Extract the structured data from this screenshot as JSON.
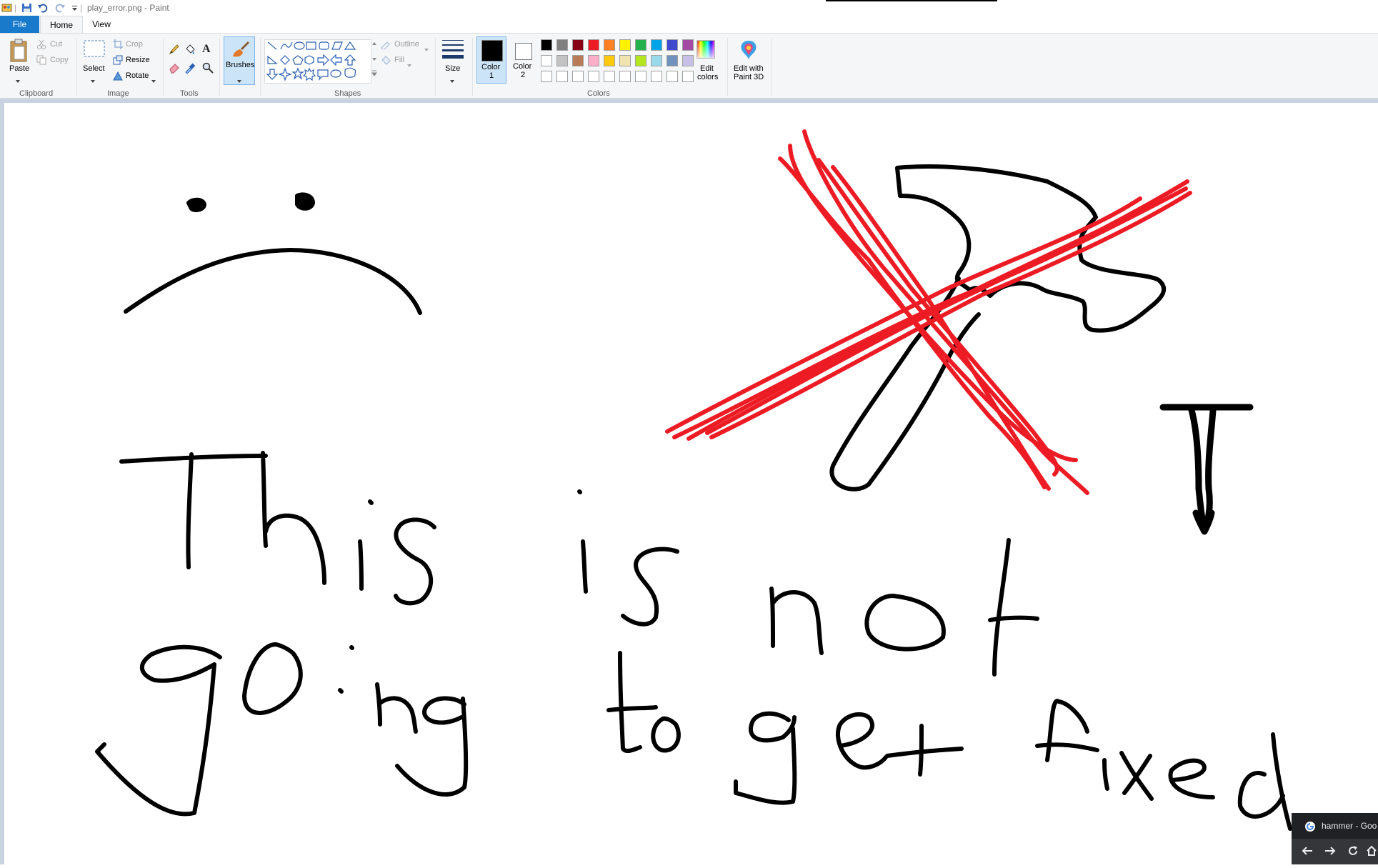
{
  "window": {
    "title": "play_error.png - Paint"
  },
  "tabs": {
    "file": "File",
    "home": "Home",
    "view": "View"
  },
  "clipboard": {
    "paste": "Paste",
    "cut": "Cut",
    "copy": "Copy",
    "label": "Clipboard"
  },
  "image": {
    "select": "Select",
    "crop": "Crop",
    "resize": "Resize",
    "rotate": "Rotate",
    "label": "Image"
  },
  "tools": {
    "label": "Tools"
  },
  "brushes": {
    "label": "Brushes"
  },
  "shapes": {
    "outline": "Outline",
    "fill": "Fill",
    "label": "Shapes"
  },
  "size": {
    "label": "Size"
  },
  "colors": {
    "color1": "Color\n1",
    "color1_a": "Color",
    "color1_b": "1",
    "color2_a": "Color",
    "color2_b": "2",
    "edit": "Edit",
    "edit2": "colors",
    "paint3d_a": "Edit with",
    "paint3d_b": "Paint 3D",
    "label": "Colors",
    "row1": [
      "#000000",
      "#7f7f7f",
      "#880015",
      "#ed1c24",
      "#ff7f27",
      "#fff200",
      "#22b14c",
      "#00a2e8",
      "#3f48cc",
      "#a349a4"
    ],
    "row2": [
      "#ffffff",
      "#c3c3c3",
      "#b97a57",
      "#ffaec9",
      "#ffc90e",
      "#efe4b0",
      "#b5e61d",
      "#99d9ea",
      "#7092be",
      "#c8bfe7"
    ],
    "row3": [
      "#ffffff",
      "#ffffff",
      "#ffffff",
      "#ffffff",
      "#ffffff",
      "#ffffff",
      "#ffffff",
      "#ffffff",
      "#ffffff",
      "#ffffff"
    ],
    "active_color1": "#000000",
    "active_color2": "#ffffff"
  },
  "chrome": {
    "tab_label": "hammer - Goo"
  }
}
